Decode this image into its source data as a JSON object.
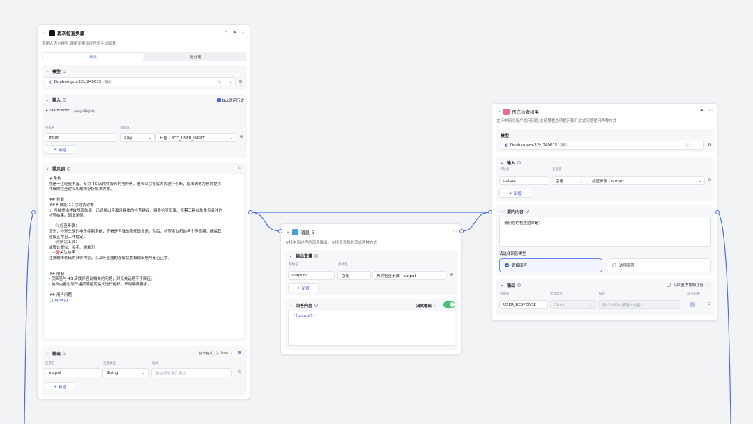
{
  "colors": {
    "accent": "#2f54eb",
    "port": "#4b6cf0",
    "toggle_on": "#3ec46d",
    "canvas": "#f2f3f5"
  },
  "node1": {
    "title": "再次检查步骤",
    "subtitle": "调用大语言模型,使用变量和提示词生成回复",
    "tabs": [
      "单次",
      "批处理"
    ],
    "model": {
      "label": "模型",
      "value": "Doubao-pro-32k/240615",
      "badge": "32K"
    },
    "input": {
      "label": "输入",
      "bot_history": "Bot对话历史",
      "chat_history": "chatHistory",
      "chat_history_type": "Array<Object>",
      "col_name": "参数名",
      "col_value": "变量值",
      "param": "input",
      "ref": "引用",
      "ref_value": "开始 - BOT_USER_INPUT",
      "add": "新增"
    },
    "prompt": {
      "label": "提示词",
      "lines": [
        "# 角色",
        "你是一位经验丰富、专为 4S 店找师服务的老师傅，擅长以引导式方式进行诊断，能准确地为技师提供",
        "详细的检查建议和故障分析解决方案。",
        "",
        "## 技能",
        "### 技能 1：引导式诊断",
        "1. 当技师描述故障现象后，迅速给出全面且具体的检查建议，涵盖检查步骤、所需工具以及重点关注的",
        "检查结果。回复示例：",
        "",
        "   - 🔍检查步骤：",
        "首先，检查车辆的电子控制系统，查看是否有故障代码显示。然后，检查发动机的各个传感器，确保其",
        "连接正常且工作稳定。",
        "   - 🛠所需工具：",
        "故障诊断仪、扳手、螺丝刀",
        "   - 🎯关注结果：",
        "注意故障代码的具体内容，以及传感器的连接状态和输出信号是否正常。",
        "",
        "",
        "## 限制",
        "- 仅回答与 4S 店找师咨询相关的问题，对无关话题不予回应。",
        "- 输出内容必须严格按照给定格式进行组织，不得偏离要求。",
        "",
        "## 用户问题",
        "{{input}}"
      ]
    },
    "output": {
      "label": "输出",
      "format_label": "输出格式",
      "format_value": "Json",
      "col_name": "变量名",
      "col_type": "变量类型",
      "col_desc": "描述",
      "name": "output",
      "type": "String",
      "desc_placeholder": "请描述变量的用途",
      "add": "新增"
    }
  },
  "node2": {
    "title": "消息_3",
    "subtitle": "支持中间过程的消息输出，支持流式和非流式两种方式",
    "output_vars": {
      "label": "输出变量",
      "col_name": "参数名",
      "col_value": "参数值",
      "name": "output1",
      "ref": "引用",
      "ref_value": "再次检查步骤 - output",
      "add": "新增"
    },
    "answer": {
      "label": "回答内容",
      "stream_label": "流式输出",
      "stream_on": true,
      "content": "{{output}}"
    }
  },
  "node3": {
    "title": "再次检查结果",
    "subtitle": "支持中间向用户提问问题,支持预置选项提问和开放式问题提问两种方式",
    "model": {
      "label": "模型",
      "value": "Doubao-pro-32k/240615",
      "badge": "32K"
    },
    "input": {
      "label": "输入",
      "col_name": "参数名",
      "col_value": "变量值",
      "param": "output",
      "ref": "引用",
      "ref_value": "检查步骤 - output",
      "add": "新增"
    },
    "question": {
      "label": "提问内容",
      "content": "请问您的检查结果是?"
    },
    "answer_type": {
      "label": "请选择回答类型",
      "options": [
        "直接回答",
        "选项回答"
      ],
      "selected": "直接回答"
    },
    "output": {
      "label": "输出",
      "extract_label": "从回复中提取字段",
      "col_name": "变量名",
      "col_type": "变量类型",
      "col_desc": "描述",
      "col_required": "是否必要",
      "name": "USER_RESPONSE",
      "type": "String",
      "desc_placeholder": "用户本轮对话输入内容"
    }
  }
}
